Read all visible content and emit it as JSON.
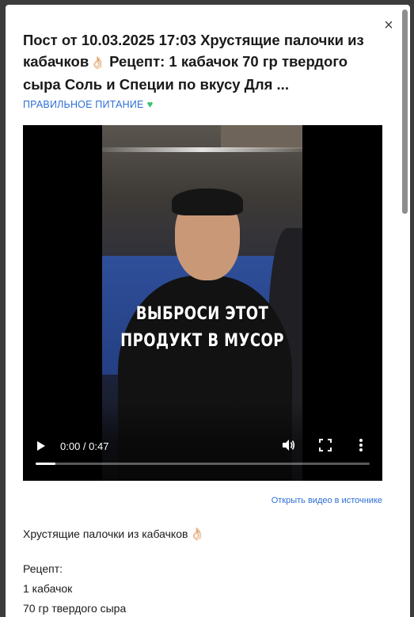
{
  "post": {
    "title": "Пост от 10.03.2025 17:03 Хрустящие палочки из кабачков",
    "title_cont": "Рецепт: 1 кабачок 70 гр твердого сыра Соль и Специи по вкусу Для ...",
    "category": "ПРАВИЛЬНОЕ ПИТАНИЕ"
  },
  "video": {
    "caption_line1": "ВЫБРОСИ ЭТОТ",
    "caption_line2": "ПРОДУКТ В МУСОР",
    "time": "0:00 / 0:47",
    "progress": 0.06,
    "source_link": "Открыть видео в источнике"
  },
  "content": {
    "line1": "Хрустящие палочки из кабачков",
    "line2": "Рецепт:",
    "line3": "1 кабачок",
    "line4": "70 гр твердого сыра"
  },
  "icons": {
    "close": "close-icon",
    "hand": "ok-hand-emoji",
    "heart": "green-heart-emoji",
    "play": "play-icon",
    "volume": "volume-icon",
    "fullscreen": "fullscreen-icon",
    "more": "more-vertical-icon"
  },
  "colors": {
    "link": "#2d6fd6",
    "heart": "#34c46a"
  }
}
